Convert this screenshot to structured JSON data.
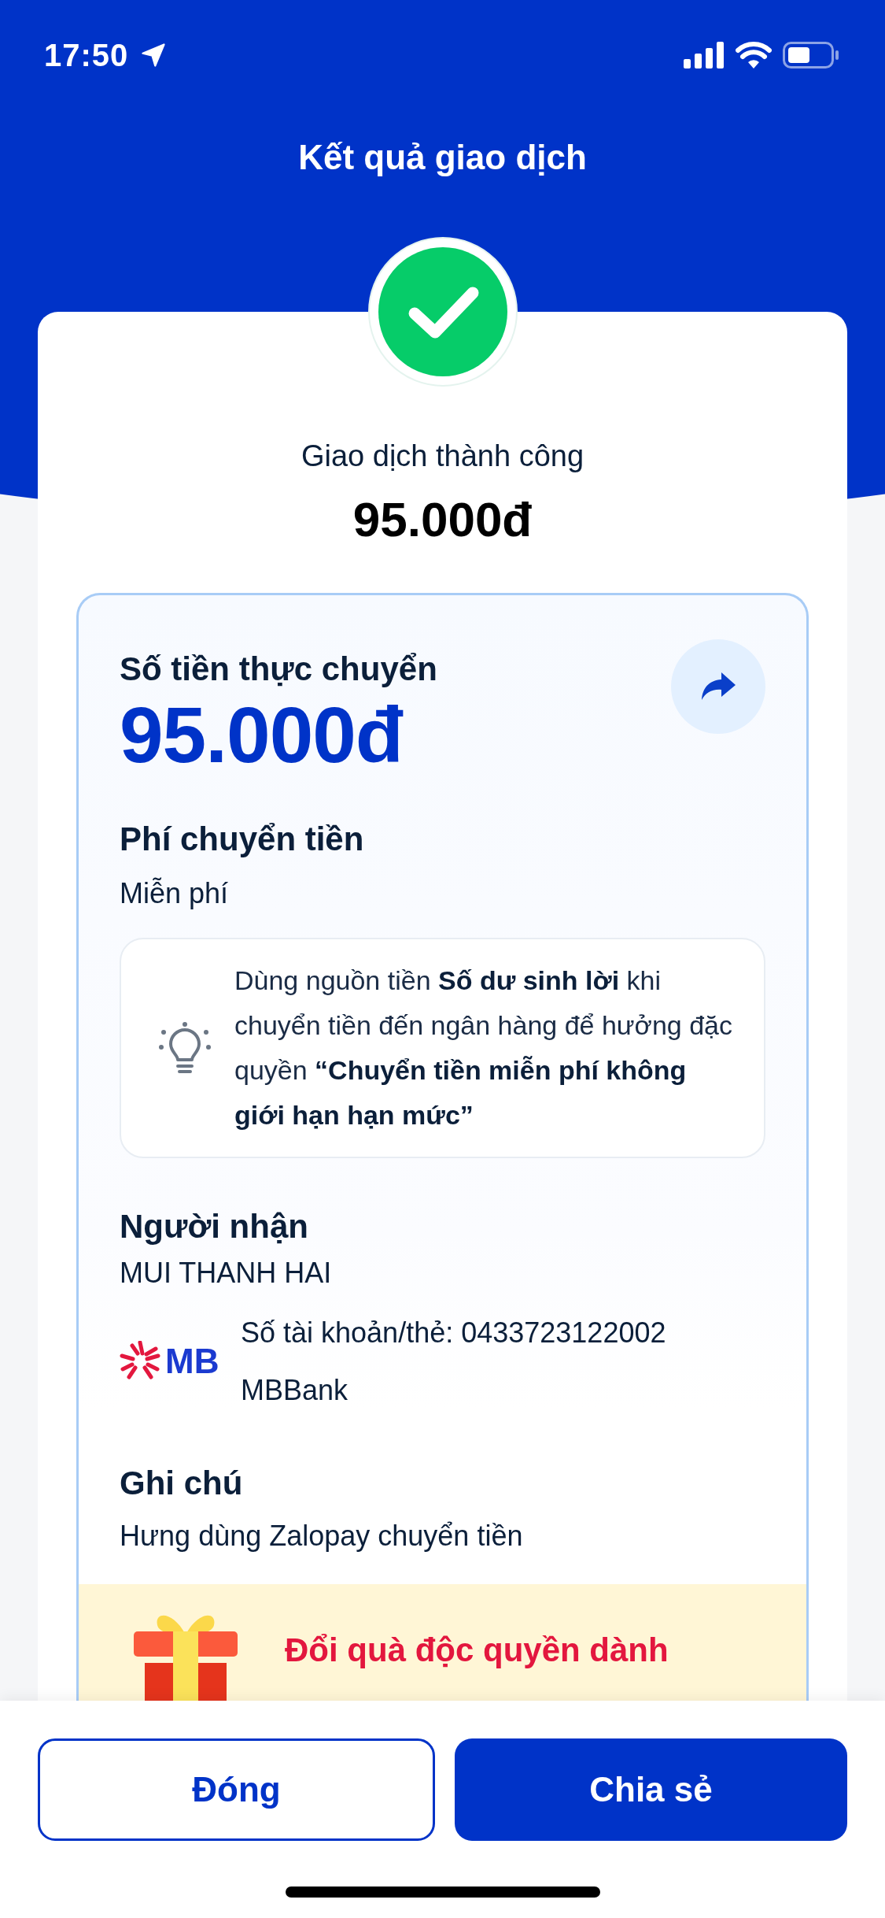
{
  "status_bar": {
    "time": "17:50"
  },
  "header": {
    "title": "Kết quả giao dịch"
  },
  "result": {
    "status": "Giao dịch thành công",
    "amount": "95.000đ"
  },
  "details": {
    "amount_label": "Số tiền thực chuyển",
    "amount": "95.000đ",
    "fee_label": "Phí chuyển tiền",
    "fee": "Miễn phí",
    "tip": "Dùng nguồn tiền **Số dư sinh lời** khi chuyển tiền đến ngân hàng để hưởng đặc quyền **“Chuyển tiền miễn phí không giới hạn hạn mức”**",
    "recipient_label": "Người nhận",
    "recipient_name": "MUI THANH HAI",
    "bank_logo": "MB",
    "account": "Số tài khoản/thẻ: 0433723122002",
    "bank_name": "MBBank",
    "note_label": "Ghi chú",
    "note": "Hưng dùng Zalopay chuyển tiền"
  },
  "promo": {
    "text": "Đổi quà độc quyền dành"
  },
  "buttons": [
    {
      "label": "Đóng",
      "kind": "secondary"
    },
    {
      "label": "Chia sẻ",
      "kind": "primary"
    }
  ]
}
